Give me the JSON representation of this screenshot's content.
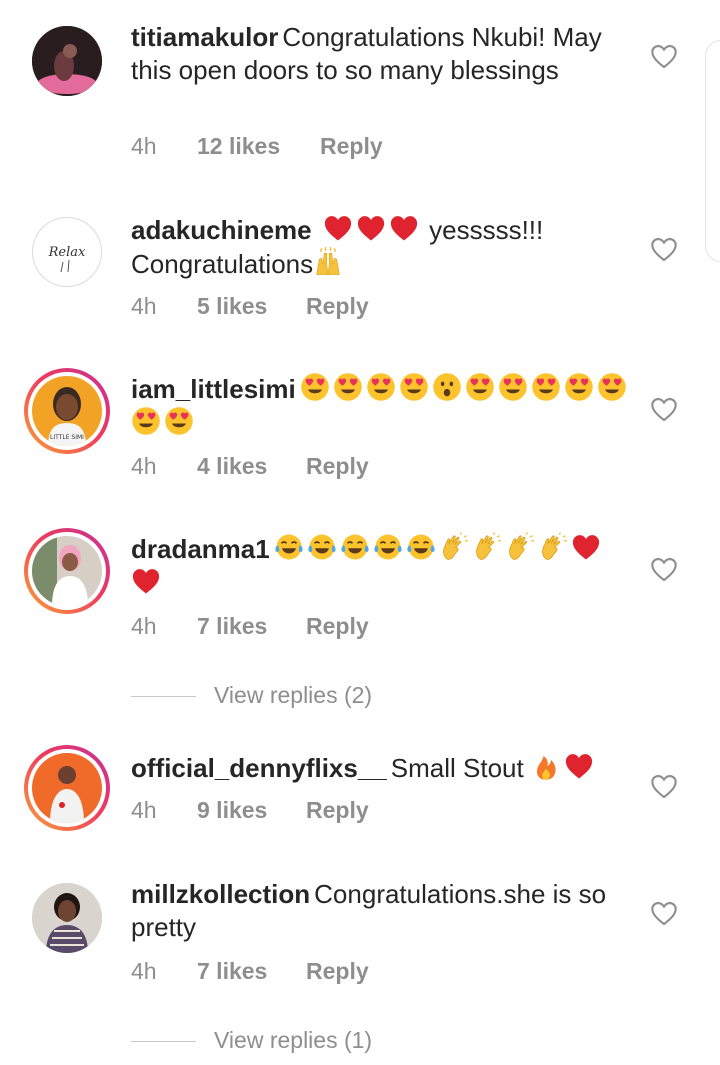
{
  "comments": [
    {
      "username": "titiamakulor",
      "text": "Congratulations Nkubi! May this open doors to so many blessings",
      "time": "4h",
      "likes": "12 likes",
      "reply": "Reply",
      "avatar": "dark-photo",
      "story_ring": false
    },
    {
      "username": "adakuchineme",
      "text_before": "",
      "emoji": [
        "red-heart",
        "red-heart",
        "red-heart"
      ],
      "text": "yesssss!!!",
      "text_line2": "Congratulations",
      "emoji2": [
        "raising-hands"
      ],
      "time": "4h",
      "likes": "5 likes",
      "reply": "Reply",
      "avatar": "relax-logo",
      "avatar_text": "Relax",
      "story_ring": false
    },
    {
      "username": "iam_littlesimi",
      "emoji": [
        "heart-eyes",
        "heart-eyes",
        "heart-eyes",
        "heart-eyes",
        "astonished",
        "heart-eyes",
        "heart-eyes",
        "heart-eyes",
        "heart-eyes",
        "heart-eyes",
        "heart-eyes",
        "heart-eyes"
      ],
      "time": "4h",
      "likes": "4 likes",
      "reply": "Reply",
      "avatar": "cartoon-portrait",
      "avatar_text": "LITTLE SIMI",
      "story_ring": true
    },
    {
      "username": "dradanma1",
      "emoji": [
        "tears-of-joy",
        "tears-of-joy",
        "tears-of-joy",
        "tears-of-joy",
        "tears-of-joy",
        "clapping",
        "clapping",
        "clapping",
        "clapping",
        "red-heart",
        "red-heart"
      ],
      "time": "4h",
      "likes": "7 likes",
      "reply": "Reply",
      "view_replies": "View replies (2)",
      "avatar": "pink-photo",
      "story_ring": true
    },
    {
      "username": "official_dennyflixs__",
      "text": "Small Stout",
      "emoji": [
        "fire",
        "red-heart"
      ],
      "time": "4h",
      "likes": "9 likes",
      "reply": "Reply",
      "avatar": "orange-photo",
      "story_ring": true
    },
    {
      "username": "millzkollection",
      "text": "Congratulations.she is so pretty",
      "time": "4h",
      "likes": "7 likes",
      "reply": "Reply",
      "view_replies": "View replies (1)",
      "avatar": "woman-photo",
      "story_ring": false
    }
  ],
  "colors": {
    "text": "#262626",
    "meta": "#8e8e8e",
    "heart_outline": "#8e8e8e",
    "red_heart": "#e0242f"
  },
  "icons": {
    "like": "heart-outline-icon"
  }
}
